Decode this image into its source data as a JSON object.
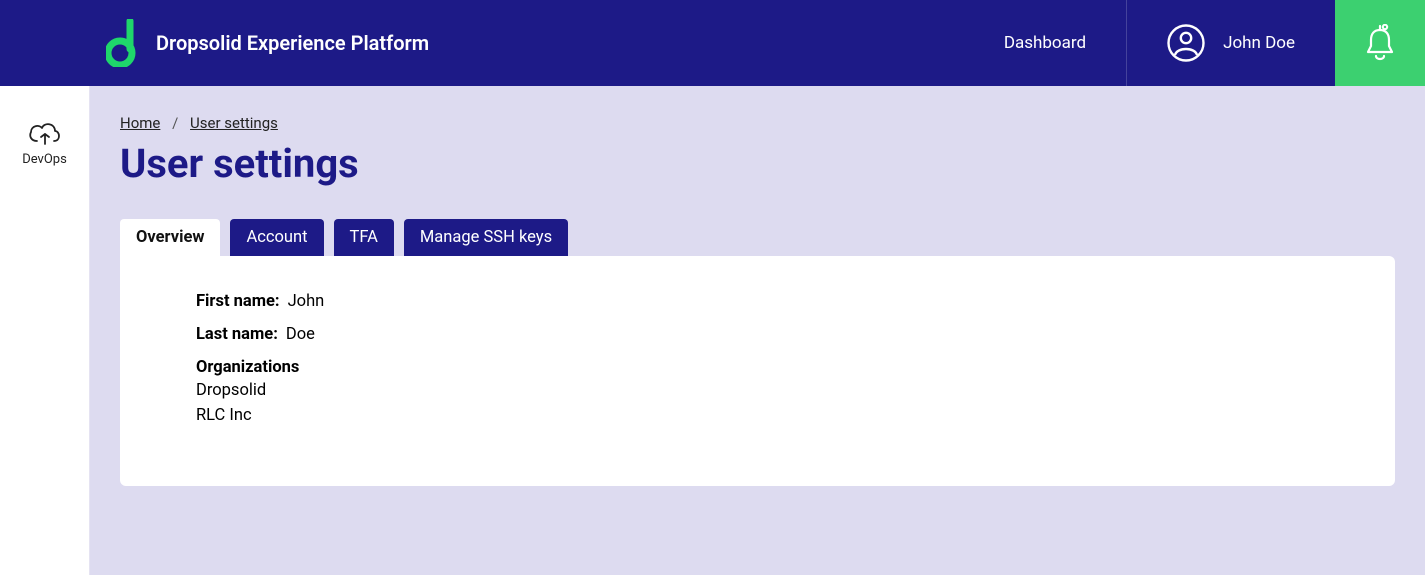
{
  "header": {
    "platform_name": "Dropsolid Experience Platform",
    "dashboard_label": "Dashboard",
    "user_name": "John Doe"
  },
  "sidebar": {
    "devops_label": "DevOps"
  },
  "breadcrumb": {
    "home": "Home",
    "current": "User settings"
  },
  "page": {
    "title": "User settings"
  },
  "tabs": {
    "overview": "Overview",
    "account": "Account",
    "tfa": "TFA",
    "ssh": "Manage SSH keys"
  },
  "overview": {
    "first_name_label": "First name:",
    "first_name_value": "John",
    "last_name_label": "Last name:",
    "last_name_value": "Doe",
    "organizations_label": "Organizations",
    "organizations": [
      "Dropsolid",
      "RLC Inc"
    ]
  }
}
